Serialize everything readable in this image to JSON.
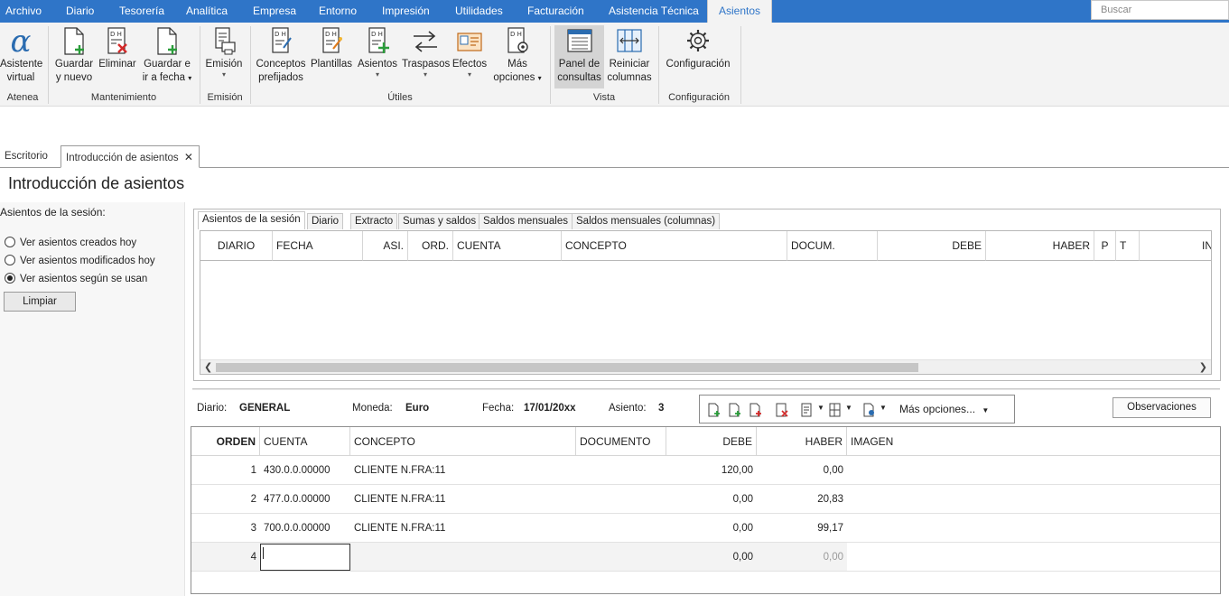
{
  "menu": {
    "items": [
      "Archivo",
      "Diario",
      "Tesorería",
      "Analítica",
      "Empresa",
      "Entorno",
      "Impresión",
      "Utilidades",
      "Facturación",
      "Asistencia Técnica"
    ],
    "active": "Asientos",
    "search_placeholder": "Buscar"
  },
  "ribbon": {
    "asistente": [
      "Asistente",
      "virtual"
    ],
    "guardar_nuevo": [
      "Guardar",
      "y nuevo"
    ],
    "eliminar": "Eliminar",
    "guardar_fecha": [
      "Guardar e",
      "ir a fecha"
    ],
    "emision": "Emisión",
    "conceptos": [
      "Conceptos",
      "prefijados"
    ],
    "plantillas": "Plantillas",
    "asientos": "Asientos",
    "traspasos": "Traspasos",
    "efectos": "Efectos",
    "mas_opciones": [
      "Más",
      "opciones"
    ],
    "panel": [
      "Panel de",
      "consultas"
    ],
    "reiniciar": [
      "Reiniciar",
      "columnas"
    ],
    "configuracion": "Configuración",
    "groups": {
      "atenea": "Atenea",
      "mantenimiento": "Mantenimiento",
      "emision": "Emisión",
      "utiles": "Útiles",
      "vista": "Vista",
      "configuracion": "Configuración"
    }
  },
  "doc_tabs": {
    "escritorio": "Escritorio",
    "introduccion": "Introducción de asientos",
    "close": "✕"
  },
  "page_title": "Introducción de asientos",
  "left_panel": {
    "title": "Asientos de la sesión:",
    "options": [
      "Ver asientos creados hoy",
      "Ver asientos modificados hoy",
      "Ver asientos según se usan"
    ],
    "selected_index": 2,
    "limpiar": "Limpiar"
  },
  "subtabs": [
    "Asientos de la sesión",
    "Diario",
    "Extracto",
    "Sumas y saldos",
    "Saldos mensuales",
    "Saldos mensuales (columnas)"
  ],
  "session_grid": {
    "headers": [
      "DIARIO",
      "FECHA",
      "ASI.",
      "ORD.",
      "CUENTA",
      "CONCEPTO",
      "DOCUM.",
      "DEBE",
      "HABER",
      "P",
      "T",
      "IN"
    ]
  },
  "entry": {
    "diario_label": "Diario:",
    "diario_value": "GENERAL",
    "moneda_label": "Moneda:",
    "moneda_value": "Euro",
    "fecha_label": "Fecha:",
    "fecha_value": "17/01/20xx",
    "asiento_label": "Asiento:",
    "asiento_value": "3",
    "mas_opciones": "Más opciones...",
    "observaciones": "Observaciones"
  },
  "lines_grid": {
    "headers": [
      "ORDEN",
      "CUENTA",
      "CONCEPTO",
      "DOCUMENTO",
      "DEBE",
      "HABER",
      "IMAGEN"
    ],
    "rows": [
      {
        "orden": "1",
        "cuenta": "430.0.0.00000",
        "concepto": "CLIENTE N.FRA:11",
        "documento": "",
        "debe": "120,00",
        "haber": "0,00"
      },
      {
        "orden": "2",
        "cuenta": "477.0.0.00000",
        "concepto": "CLIENTE N.FRA:11",
        "documento": "",
        "debe": "0,00",
        "haber": "20,83"
      },
      {
        "orden": "3",
        "cuenta": "700.0.0.00000",
        "concepto": "CLIENTE N.FRA:11",
        "documento": "",
        "debe": "0,00",
        "haber": "99,17"
      },
      {
        "orden": "4",
        "cuenta": "",
        "concepto": "",
        "documento": "",
        "debe": "0,00",
        "haber": "0,00"
      }
    ]
  },
  "colors": {
    "menubar": "#2f75c8",
    "ribbon": "#f3f3f3",
    "icon_green": "#2a9d3a",
    "icon_red": "#d42a2a",
    "icon_blue": "#2b6cb0"
  }
}
